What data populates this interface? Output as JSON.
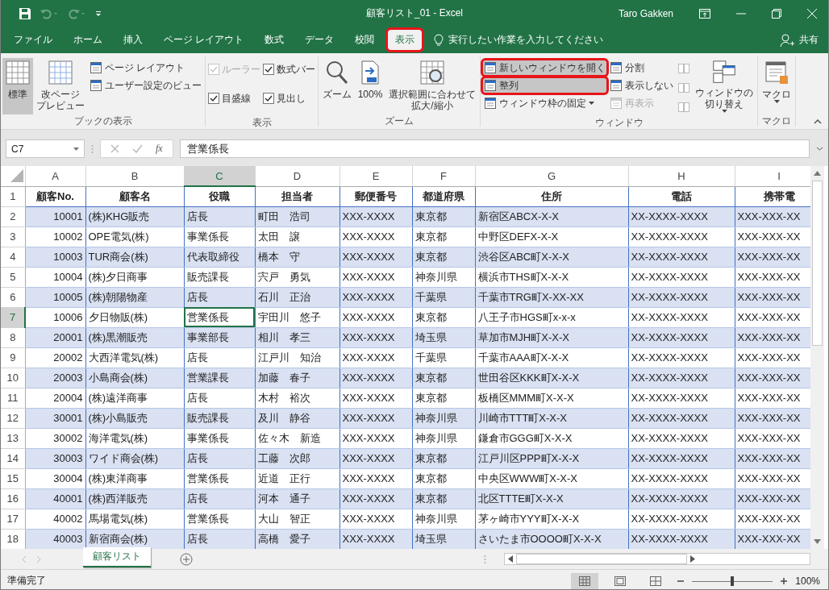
{
  "window": {
    "title": "顧客リスト_01 - Excel",
    "user": "Taro Gakken"
  },
  "tabs": [
    {
      "label": "ファイル",
      "selected": false,
      "highlighted": false
    },
    {
      "label": "ホーム",
      "selected": false,
      "highlighted": false
    },
    {
      "label": "挿入",
      "selected": false,
      "highlighted": false
    },
    {
      "label": "ページ レイアウト",
      "selected": false,
      "highlighted": false
    },
    {
      "label": "数式",
      "selected": false,
      "highlighted": false
    },
    {
      "label": "データ",
      "selected": false,
      "highlighted": false
    },
    {
      "label": "校閲",
      "selected": false,
      "highlighted": false
    },
    {
      "label": "表示",
      "selected": true,
      "highlighted": true
    }
  ],
  "tell_me": {
    "placeholder": "実行したい作業を入力してください"
  },
  "share": "共有",
  "ribbon": [
    {
      "label": "ブックの表示",
      "columns": [
        [
          {
            "kind": "large",
            "lines": [
              "標準"
            ],
            "selected": true
          }
        ],
        [
          {
            "kind": "large",
            "lines": [
              "改ページ",
              "プレビュー"
            ],
            "selected": false
          }
        ],
        [
          {
            "kind": "small",
            "label": "ページ レイアウト"
          },
          {
            "kind": "small",
            "label": "ユーザー設定のビュー"
          }
        ]
      ]
    },
    {
      "label": "表示",
      "columns": [
        [
          {
            "kind": "check",
            "label": "ルーラー",
            "checked": true,
            "disabled": true
          },
          {
            "kind": "check",
            "label": "目盛線",
            "checked": true,
            "disabled": false
          }
        ],
        [
          {
            "kind": "check",
            "label": "数式バー",
            "checked": true,
            "disabled": false
          },
          {
            "kind": "check",
            "label": "見出し",
            "checked": true,
            "disabled": false
          }
        ]
      ]
    },
    {
      "label": "ズーム",
      "columns": [
        [
          {
            "kind": "large",
            "lines": [
              "ズーム"
            ],
            "selected": false
          }
        ],
        [
          {
            "kind": "large",
            "lines": [
              "100%"
            ],
            "selected": false
          }
        ],
        [
          {
            "kind": "large",
            "lines": [
              "選択範囲に合わせて",
              "拡大/縮小"
            ],
            "selected": false
          }
        ]
      ]
    },
    {
      "label": "ウィンドウ",
      "columns": [
        [
          {
            "kind": "small",
            "label": "新しいウィンドウを開く",
            "highlighted": true
          },
          {
            "kind": "small",
            "label": "整列",
            "highlighted": true
          },
          {
            "kind": "small",
            "label": "ウィンドウ枠の固定",
            "dropdown": true
          }
        ],
        [
          {
            "kind": "small",
            "label": "分割"
          },
          {
            "kind": "small",
            "label": "表示しない"
          },
          {
            "kind": "small",
            "label": "再表示",
            "disabled": true
          }
        ],
        [
          {
            "kind": "icon",
            "disabled": true
          },
          {
            "kind": "icon",
            "disabled": true
          },
          {
            "kind": "icon",
            "disabled": true
          }
        ],
        [
          {
            "kind": "large",
            "lines": [
              "ウィンドウの",
              "切り替え"
            ],
            "selected": false,
            "dropdown": true
          }
        ]
      ]
    },
    {
      "label": "マクロ",
      "columns": [
        [
          {
            "kind": "large",
            "lines": [
              "マクロ"
            ],
            "selected": false,
            "dropdown": true
          }
        ]
      ]
    }
  ],
  "formula_bar": {
    "name_box": "C7",
    "fx": "fx",
    "value": "営業係長"
  },
  "columns": [
    {
      "label": "A",
      "selected": false
    },
    {
      "label": "B",
      "selected": false
    },
    {
      "label": "C",
      "selected": true
    },
    {
      "label": "D",
      "selected": false
    },
    {
      "label": "E",
      "selected": false
    },
    {
      "label": "F",
      "selected": false
    },
    {
      "label": "G",
      "selected": false
    },
    {
      "label": "H",
      "selected": false
    },
    {
      "label": "I",
      "selected": false
    }
  ],
  "rows": [
    {
      "n": "1",
      "selected": false,
      "banded": false,
      "header": true,
      "cells": [
        "顧客No.",
        "顧客名",
        "役職",
        "担当者",
        "郵便番号",
        "都道府県",
        "住所",
        "電話",
        "携帯電"
      ]
    },
    {
      "n": "2",
      "selected": false,
      "banded": true,
      "cells": [
        "10001",
        "(株)KHG販売",
        "店長",
        "町田　浩司",
        "XXX-XXXX",
        "東京都",
        "新宿区ABCX-X-X",
        "XX-XXXX-XXXX",
        "XXX-XXX-XX"
      ]
    },
    {
      "n": "3",
      "selected": false,
      "banded": false,
      "cells": [
        "10002",
        "OPE電気(株)",
        "事業係長",
        "太田　譲",
        "XXX-XXXX",
        "東京都",
        "中野区DEFX-X-X",
        "XX-XXXX-XXXX",
        "XXX-XXX-XX"
      ]
    },
    {
      "n": "4",
      "selected": false,
      "banded": true,
      "cells": [
        "10003",
        "TUR商会(株)",
        "代表取締役",
        "橋本　守",
        "XXX-XXXX",
        "東京都",
        "渋谷区ABC町X-X-X",
        "XX-XXXX-XXXX",
        "XXX-XXX-XX"
      ]
    },
    {
      "n": "5",
      "selected": false,
      "banded": false,
      "cells": [
        "10004",
        "(株)夕日商事",
        "販売課長",
        "宍戸　勇気",
        "XXX-XXXX",
        "神奈川県",
        "横浜市THS町X-X-X",
        "XX-XXXX-XXXX",
        "XXX-XXX-XX"
      ]
    },
    {
      "n": "6",
      "selected": false,
      "banded": true,
      "cells": [
        "10005",
        "(株)朝陽物産",
        "店長",
        "石川　正治",
        "XXX-XXXX",
        "千葉県",
        "千葉市TRG町X-XX-XX",
        "XX-XXXX-XXXX",
        "XXX-XXX-XX"
      ]
    },
    {
      "n": "7",
      "selected": true,
      "banded": false,
      "cells": [
        "10006",
        "夕日物販(株)",
        "営業係長",
        "宇田川　悠子",
        "XXX-XXXX",
        "東京都",
        "八王子市HGS町x-x-x",
        "XX-XXXX-XXXX",
        "XXX-XXX-XX"
      ]
    },
    {
      "n": "8",
      "selected": false,
      "banded": true,
      "cells": [
        "20001",
        "(株)黒潮販売",
        "事業部長",
        "相川　孝三",
        "XXX-XXXX",
        "埼玉県",
        "草加市MJH町X-X-X",
        "XX-XXXX-XXXX",
        "XXX-XXX-XX"
      ]
    },
    {
      "n": "9",
      "selected": false,
      "banded": false,
      "cells": [
        "20002",
        "大西洋電気(株)",
        "店長",
        "江戸川　知治",
        "XXX-XXXX",
        "千葉県",
        "千葉市AAA町X-X-X",
        "XX-XXXX-XXXX",
        "XXX-XXX-XX"
      ]
    },
    {
      "n": "10",
      "selected": false,
      "banded": true,
      "cells": [
        "20003",
        "小島商会(株)",
        "営業課長",
        "加藤　春子",
        "XXX-XXXX",
        "東京都",
        "世田谷区KKK町X-X-X",
        "XX-XXXX-XXXX",
        "XXX-XXX-XX"
      ]
    },
    {
      "n": "11",
      "selected": false,
      "banded": false,
      "cells": [
        "20004",
        "(株)遠洋商事",
        "店長",
        "木村　裕次",
        "XXX-XXXX",
        "東京都",
        "板橋区MMM町X-X-X",
        "XX-XXXX-XXXX",
        "XXX-XXX-XX"
      ]
    },
    {
      "n": "12",
      "selected": false,
      "banded": true,
      "cells": [
        "30001",
        "(株)小島販売",
        "販売課長",
        "及川　静谷",
        "XXX-XXXX",
        "神奈川県",
        "川崎市TTT町X-X-X",
        "XX-XXXX-XXXX",
        "XXX-XXX-XX"
      ]
    },
    {
      "n": "13",
      "selected": false,
      "banded": false,
      "cells": [
        "30002",
        "海洋電気(株)",
        "事業係長",
        "佐々木　新造",
        "XXX-XXXX",
        "神奈川県",
        "鎌倉市GGG町X-X-X",
        "XX-XXXX-XXXX",
        "XXX-XXX-XX"
      ]
    },
    {
      "n": "14",
      "selected": false,
      "banded": true,
      "cells": [
        "30003",
        "ワイド商会(株)",
        "店長",
        "工藤　次郎",
        "XXX-XXXX",
        "東京都",
        "江戸川区PPP町X-X-X",
        "XX-XXXX-XXXX",
        "XXX-XXX-XX"
      ]
    },
    {
      "n": "15",
      "selected": false,
      "banded": false,
      "cells": [
        "30004",
        "(株)東洋商事",
        "営業係長",
        "近道　正行",
        "XXX-XXXX",
        "東京都",
        "中央区WWW町X-X-X",
        "XX-XXXX-XXXX",
        "XXX-XXX-XX"
      ]
    },
    {
      "n": "16",
      "selected": false,
      "banded": true,
      "cells": [
        "40001",
        "(株)西洋販売",
        "店長",
        "河本　通子",
        "XXX-XXXX",
        "東京都",
        "北区TTTE町X-X-X",
        "XX-XXXX-XXXX",
        "XXX-XXX-XX"
      ]
    },
    {
      "n": "17",
      "selected": false,
      "banded": false,
      "cells": [
        "40002",
        "馬場電気(株)",
        "営業係長",
        "大山　智正",
        "XXX-XXXX",
        "神奈川県",
        "茅ヶ崎市YYY町X-X-X",
        "XX-XXXX-XXXX",
        "XXX-XXX-XX"
      ]
    },
    {
      "n": "18",
      "selected": false,
      "banded": true,
      "cells": [
        "40003",
        "新宿商会(株)",
        "店長",
        "高橋　愛子",
        "XXX-XXXX",
        "埼玉県",
        "さいたま市OOOO町X-X-X",
        "XX-XXXX-XXXX",
        "XXX-XXX-XX"
      ]
    }
  ],
  "sheets": [
    {
      "label": "顧客リスト",
      "selected": true
    }
  ],
  "status_bar": {
    "text": "準備完了",
    "views": [
      {
        "selected": true
      },
      {
        "selected": false
      },
      {
        "selected": false
      }
    ],
    "zoom": {
      "level": 0.5,
      "reading": "100%"
    }
  }
}
